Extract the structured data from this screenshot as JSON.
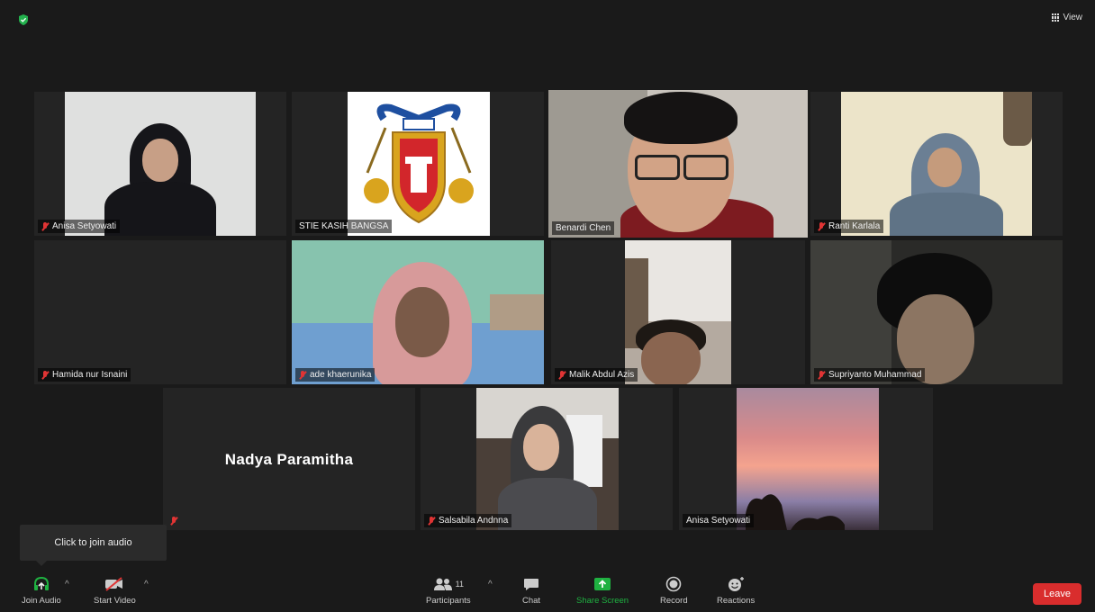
{
  "header": {
    "view_label": "View"
  },
  "participants": [
    {
      "name": "Anisa Setyowati"
    },
    {
      "name": "STIE KASIH BANGSA"
    },
    {
      "name": "Benardi Chen"
    },
    {
      "name": "Ranti Karlala"
    },
    {
      "name": "Hamida nur Isnaini"
    },
    {
      "name": "ade khaerunika"
    },
    {
      "name": "Malik Abdul Azis"
    },
    {
      "name": "Supriyanto Muhammad"
    },
    {
      "name": "Nadya Paramitha"
    },
    {
      "name": "Salsabila Andnna"
    },
    {
      "name": "Anisa Setyowati"
    }
  ],
  "tooltip": "Click to join audio",
  "toolbar": {
    "join_audio": "Join Audio",
    "start_video": "Start Video",
    "participants": "Participants",
    "participants_count": "11",
    "chat": "Chat",
    "share_screen": "Share Screen",
    "record": "Record",
    "reactions": "Reactions",
    "leave": "Leave"
  },
  "colors": {
    "active_speaker": "#c6e05a",
    "leave": "#d92d2d",
    "share_screen": "#1fb141",
    "muted": "#e03434"
  }
}
